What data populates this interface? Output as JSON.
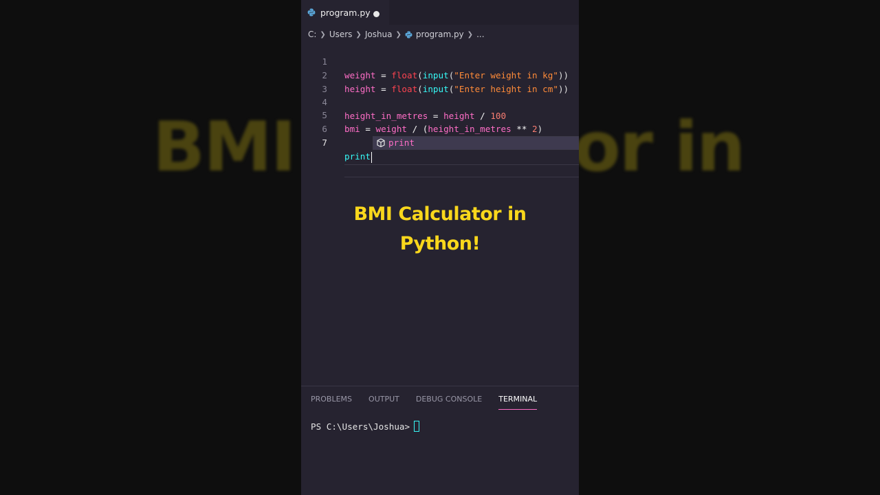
{
  "background": {
    "left_ghost_text": "BMI",
    "right_ghost_text": "or in"
  },
  "editor": {
    "tab": {
      "filename": "program.py",
      "icon": "python-icon",
      "modified": true
    },
    "breadcrumb": [
      "C:",
      "Users",
      "Joshua",
      "program.py",
      "..."
    ],
    "lines": [
      {
        "num": "1"
      },
      {
        "num": "2"
      },
      {
        "num": "3"
      },
      {
        "num": "4"
      },
      {
        "num": "5"
      },
      {
        "num": "6"
      },
      {
        "num": "7"
      }
    ],
    "code": {
      "l1": {
        "var": "weight",
        "op": " = ",
        "fn": "float",
        "p1": "(",
        "fn2": "input",
        "p2": "(",
        "str": "\"Enter weight in kg\"",
        "p3": "))"
      },
      "l2": {
        "var": "height",
        "op": " = ",
        "fn": "float",
        "p1": "(",
        "fn2": "input",
        "p2": "(",
        "str": "\"Enter height in cm\"",
        "p3": "))"
      },
      "l4": {
        "var": "height_in_metres",
        "op": " = ",
        "var2": "height",
        "op2": " / ",
        "num": "100"
      },
      "l5": {
        "var": "bmi",
        "op": " = ",
        "var2": "weight",
        "op2": " / (",
        "var3": "height_in_metres",
        "op3": " ** ",
        "num": "2",
        "p": ")"
      },
      "l7": {
        "text": "print"
      }
    },
    "suggestion": {
      "icon": "cube-icon",
      "label": "print"
    }
  },
  "caption": {
    "line1": "BMI Calculator in",
    "line2": "Python!"
  },
  "terminal": {
    "tabs": [
      "PROBLEMS",
      "OUTPUT",
      "DEBUG CONSOLE",
      "TERMINAL"
    ],
    "active_tab": "TERMINAL",
    "prompt": "PS C:\\Users\\Joshua>"
  },
  "colors": {
    "panel_bg": "#262330",
    "caption": "#f9d71c",
    "keyword_pink": "#ff6ec7",
    "builtin_red": "#fe4450",
    "builtin_cyan": "#36f9f6",
    "string_orange": "#ff8b39"
  }
}
